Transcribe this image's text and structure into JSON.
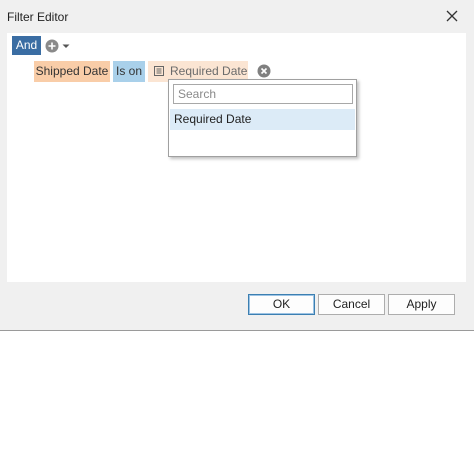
{
  "window": {
    "title": "Filter Editor"
  },
  "editor": {
    "group_operator": "And",
    "condition": {
      "field": "Shipped Date",
      "operator": "Is on",
      "value": "Required Date"
    }
  },
  "dropdown": {
    "search_placeholder": "Search",
    "items": [
      {
        "label": "Required Date",
        "selected": true
      }
    ]
  },
  "buttons": {
    "ok": "OK",
    "cancel": "Cancel",
    "apply": "Apply"
  },
  "colors": {
    "group_operator_bg": "#3a6da3",
    "field_chip_bg": "#f9cda8",
    "operator_chip_bg": "#a9d0ea",
    "value_chip_bg": "#fbe5d3",
    "selected_item_bg": "#dcebf7",
    "default_button_border": "#3c7fb1"
  },
  "icons": {
    "close": "close-icon",
    "add": "add-circle-icon",
    "dropdown_arrow": "chevron-down-icon",
    "field_value": "field-list-icon",
    "remove": "remove-circle-icon"
  }
}
